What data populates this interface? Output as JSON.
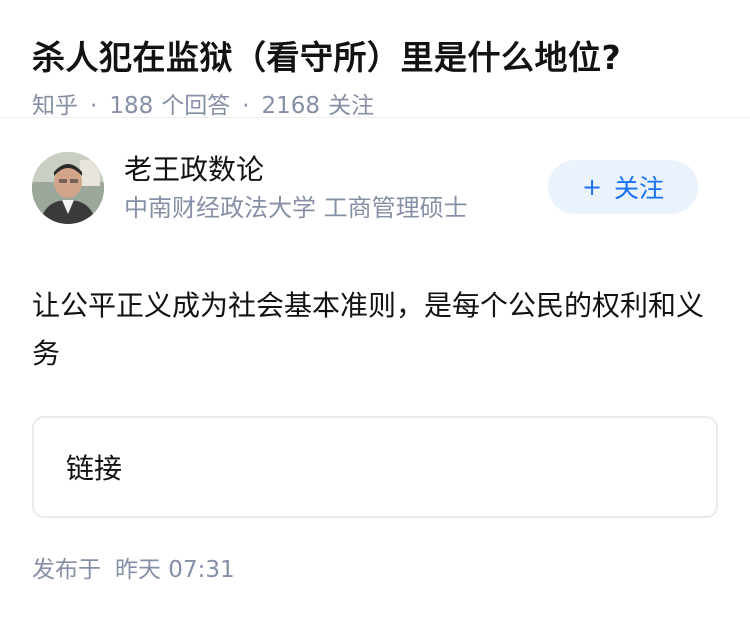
{
  "question": {
    "title": "杀人犯在监狱（看守所）里是什么地位?",
    "source": "知乎",
    "answers_count": "188",
    "answers_label": "个回答",
    "followers_count": "2168",
    "followers_label": "关注"
  },
  "author": {
    "name": "老王政数论",
    "bio": "中南财经政法大学 工商管理硕士",
    "follow_label": "关注",
    "follow_icon": "plus-icon"
  },
  "answer": {
    "content": "让公平正义成为社会基本准则，是每个公民的权利和义务",
    "link_label": "链接",
    "publish_prefix": "发布于",
    "publish_time": "昨天 07:31"
  },
  "colors": {
    "muted": "#8590a6",
    "accent": "#1772f6",
    "button_bg": "#eaf2fc"
  }
}
